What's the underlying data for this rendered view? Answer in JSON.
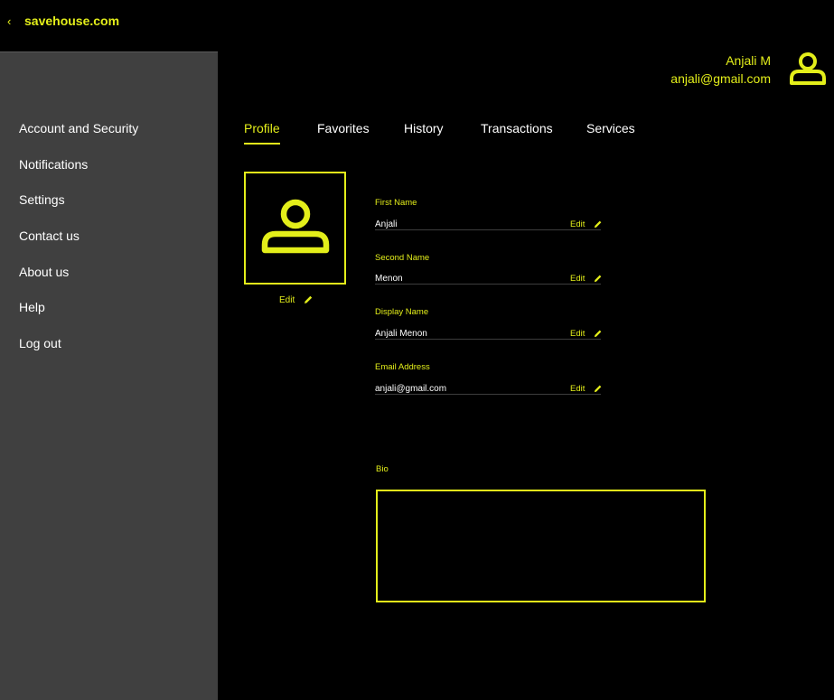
{
  "header": {
    "back_icon": "chevron-left-icon",
    "back_glyph": "‹",
    "brand": "savehouse.com"
  },
  "user": {
    "name": "Anjali M",
    "email": "anjali@gmail.com",
    "avatar_icon": "user-icon"
  },
  "sidebar": {
    "items": [
      {
        "label": "Account and Security"
      },
      {
        "label": "Notifications"
      },
      {
        "label": "Settings"
      },
      {
        "label": "Contact us"
      },
      {
        "label": "About us"
      },
      {
        "label": "Help"
      },
      {
        "label": "Log out"
      }
    ]
  },
  "tabs": [
    {
      "label": "Profile",
      "active": true
    },
    {
      "label": "Favorites",
      "active": false
    },
    {
      "label": "History",
      "active": false
    },
    {
      "label": "Transactions",
      "active": false
    },
    {
      "label": "Services",
      "active": false
    }
  ],
  "profile": {
    "photo_icon": "user-icon",
    "photo_edit_label": "Edit",
    "edit_icon": "pencil-icon",
    "fields": [
      {
        "label": "First Name",
        "value": "Anjali",
        "edit_label": "Edit"
      },
      {
        "label": "Second Name",
        "value": "Menon",
        "edit_label": "Edit"
      },
      {
        "label": "Display Name",
        "value": "Anjali Menon",
        "edit_label": "Edit"
      },
      {
        "label": "Email Address",
        "value": "anjali@gmail.com",
        "edit_label": "Edit"
      }
    ],
    "bio_label": "Bio",
    "bio_value": ""
  },
  "colors": {
    "accent": "#e3ee1a",
    "background": "#000000",
    "sidebar": "#404040",
    "text": "#ffffff"
  }
}
